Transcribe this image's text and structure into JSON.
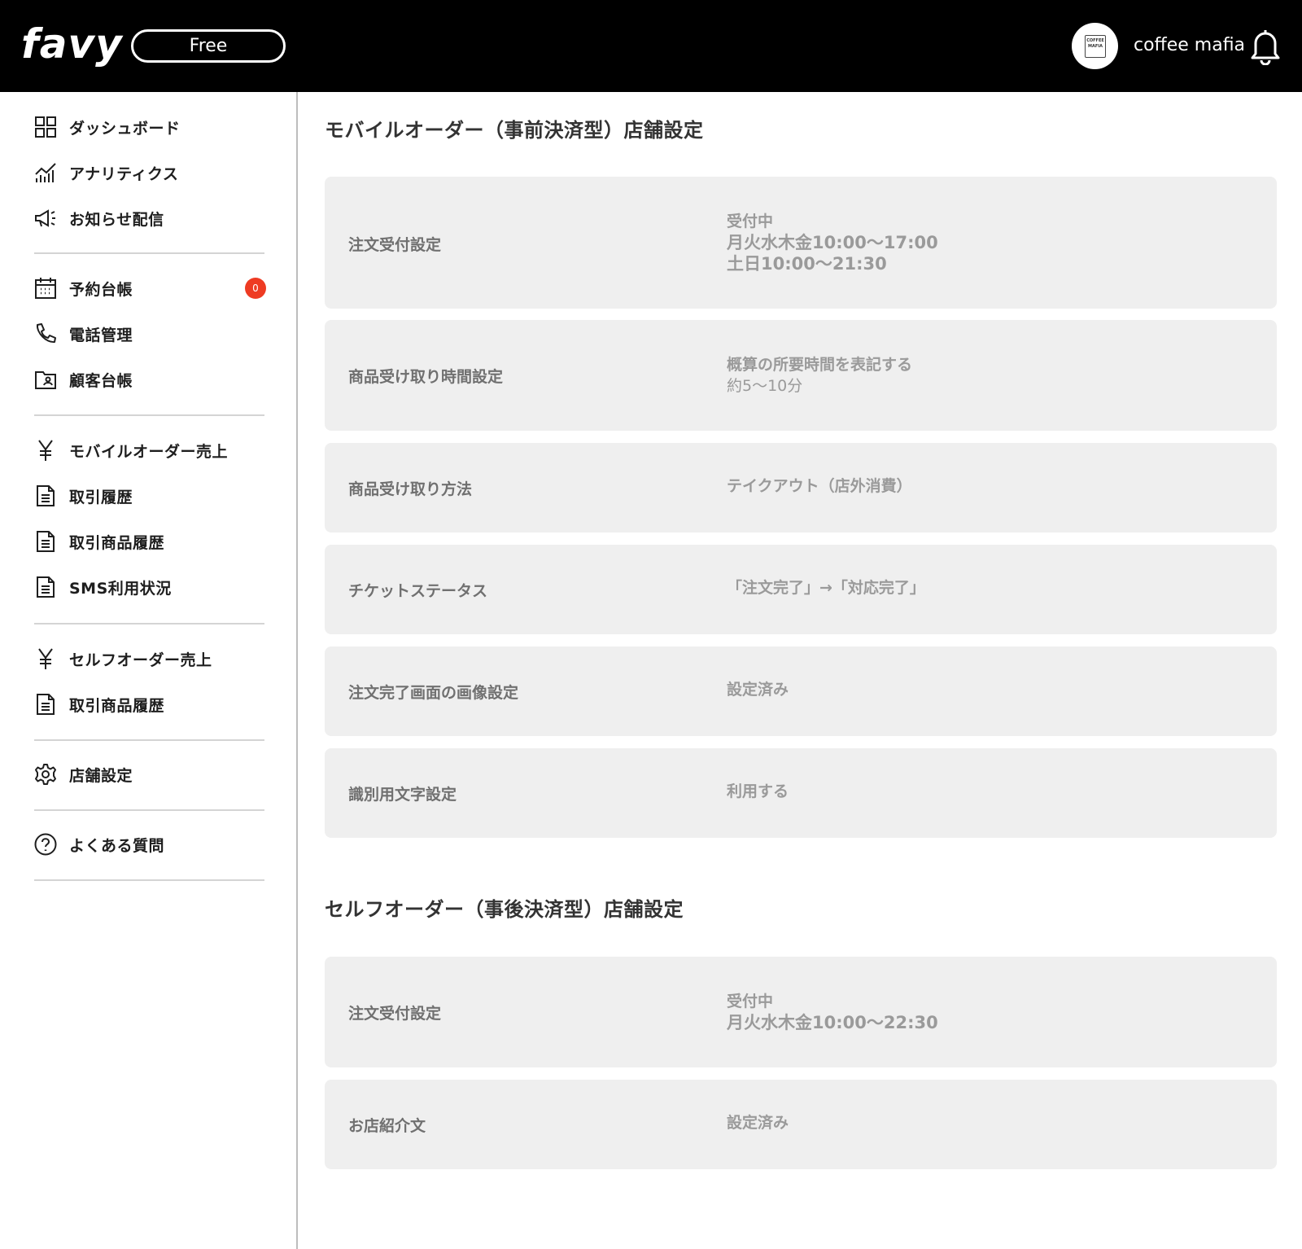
{
  "header": {
    "logo": "favy",
    "plan": "Free",
    "avatar_text": "COFFEE MAFIA",
    "store_name": "coffee mafia"
  },
  "sidebar": {
    "items": [
      {
        "label": "ダッシュボード",
        "icon": "grid-icon"
      },
      {
        "label": "アナリティクス",
        "icon": "analytics-icon"
      },
      {
        "label": "お知らせ配信",
        "icon": "megaphone-icon"
      },
      {
        "label": "予約台帳",
        "icon": "calendar-icon",
        "count": "0"
      },
      {
        "label": "電話管理",
        "icon": "phone-icon"
      },
      {
        "label": "顧客台帳",
        "icon": "customer-folder-icon"
      },
      {
        "label": "モバイルオーダー売上",
        "icon": "yen-icon"
      },
      {
        "label": "取引履歴",
        "icon": "document-icon"
      },
      {
        "label": "取引商品履歴",
        "icon": "document-icon"
      },
      {
        "label": "SMS利用状況",
        "icon": "document-icon"
      },
      {
        "label": "セルフオーダー売上",
        "icon": "yen-icon"
      },
      {
        "label": "取引商品履歴",
        "icon": "document-icon"
      },
      {
        "label": "店舗設定",
        "icon": "gear-icon"
      },
      {
        "label": "よくある質問",
        "icon": "help-icon"
      }
    ]
  },
  "mobile_order": {
    "title": "モバイルオーダー（事前決済型）店舗設定",
    "settings": [
      {
        "label": "注文受付設定",
        "values": [
          "受付中",
          "月火水木金10:00〜17:00",
          "土日10:00〜21:30"
        ]
      },
      {
        "label": "商品受け取り時間設定",
        "values": [
          "概算の所要時間を表記する",
          "約5〜10分"
        ]
      },
      {
        "label": "商品受け取り方法",
        "values": [
          "テイクアウト（店外消費）"
        ]
      },
      {
        "label": "チケットステータス",
        "values": [
          "「注文完了」→「対応完了」"
        ]
      },
      {
        "label": "注文完了画面の画像設定",
        "values": [
          "設定済み"
        ]
      },
      {
        "label": "識別用文字設定",
        "values": [
          "利用する"
        ]
      }
    ]
  },
  "self_order": {
    "title": "セルフオーダー（事後決済型）店舗設定",
    "settings": [
      {
        "label": "注文受付設定",
        "values": [
          "受付中",
          "月火水木金10:00〜22:30"
        ]
      },
      {
        "label": "お店紹介文",
        "values": [
          "設定済み"
        ]
      }
    ]
  },
  "colors": {
    "header_bg": "#000000",
    "card_bg": "#efefef",
    "badge_red": "#ee3b23"
  }
}
